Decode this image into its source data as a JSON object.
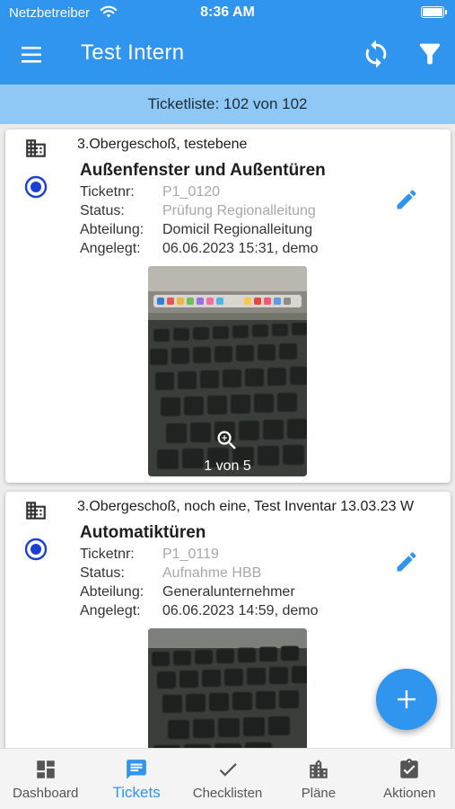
{
  "status_bar": {
    "carrier": "Netzbetreiber",
    "time": "8:36 AM"
  },
  "app_bar": {
    "title": "Test Intern",
    "icons": [
      "menu-icon",
      "sync-icon",
      "filter-icon"
    ]
  },
  "list_header": "Ticketliste: 102 von 102",
  "labels": {
    "ticketnr": "Ticketnr:",
    "status": "Status:",
    "abteilung": "Abteilung:",
    "angelegt": "Angelegt:"
  },
  "tickets": [
    {
      "location": "3.Obergeschoß, testebene",
      "title": "Außenfenster und Außentüren",
      "ticketnr": "P1_0120",
      "status": "Prüfung Regionalleitung",
      "abteilung": "Domicil Regionalleitung",
      "angelegt": "06.06.2023 15:31, demo",
      "photo_counter": "1 von 5"
    },
    {
      "location": "3.Obergeschoß, noch eine, Test Inventar 13.03.23 W",
      "title": "Automatiktüren",
      "ticketnr": "P1_0119",
      "status": "Aufnahme HBB",
      "abteilung": "Generalunternehmer",
      "angelegt": "06.06.2023 14:59, demo"
    }
  ],
  "fab": {
    "icon": "plus-icon"
  },
  "bottom_nav": {
    "items": [
      {
        "label": "Dashboard",
        "icon": "dashboard-icon"
      },
      {
        "label": "Tickets",
        "icon": "ticket-icon",
        "active": true
      },
      {
        "label": "Checklisten",
        "icon": "check-icon"
      },
      {
        "label": "Pläne",
        "icon": "building-icon"
      },
      {
        "label": "Aktionen",
        "icon": "clipboard-check-icon"
      }
    ]
  },
  "colors": {
    "primary": "#2f95ee",
    "header_band": "#8fc8f5",
    "radio": "#1a3fd6",
    "muted_text": "#a8a8a8"
  }
}
